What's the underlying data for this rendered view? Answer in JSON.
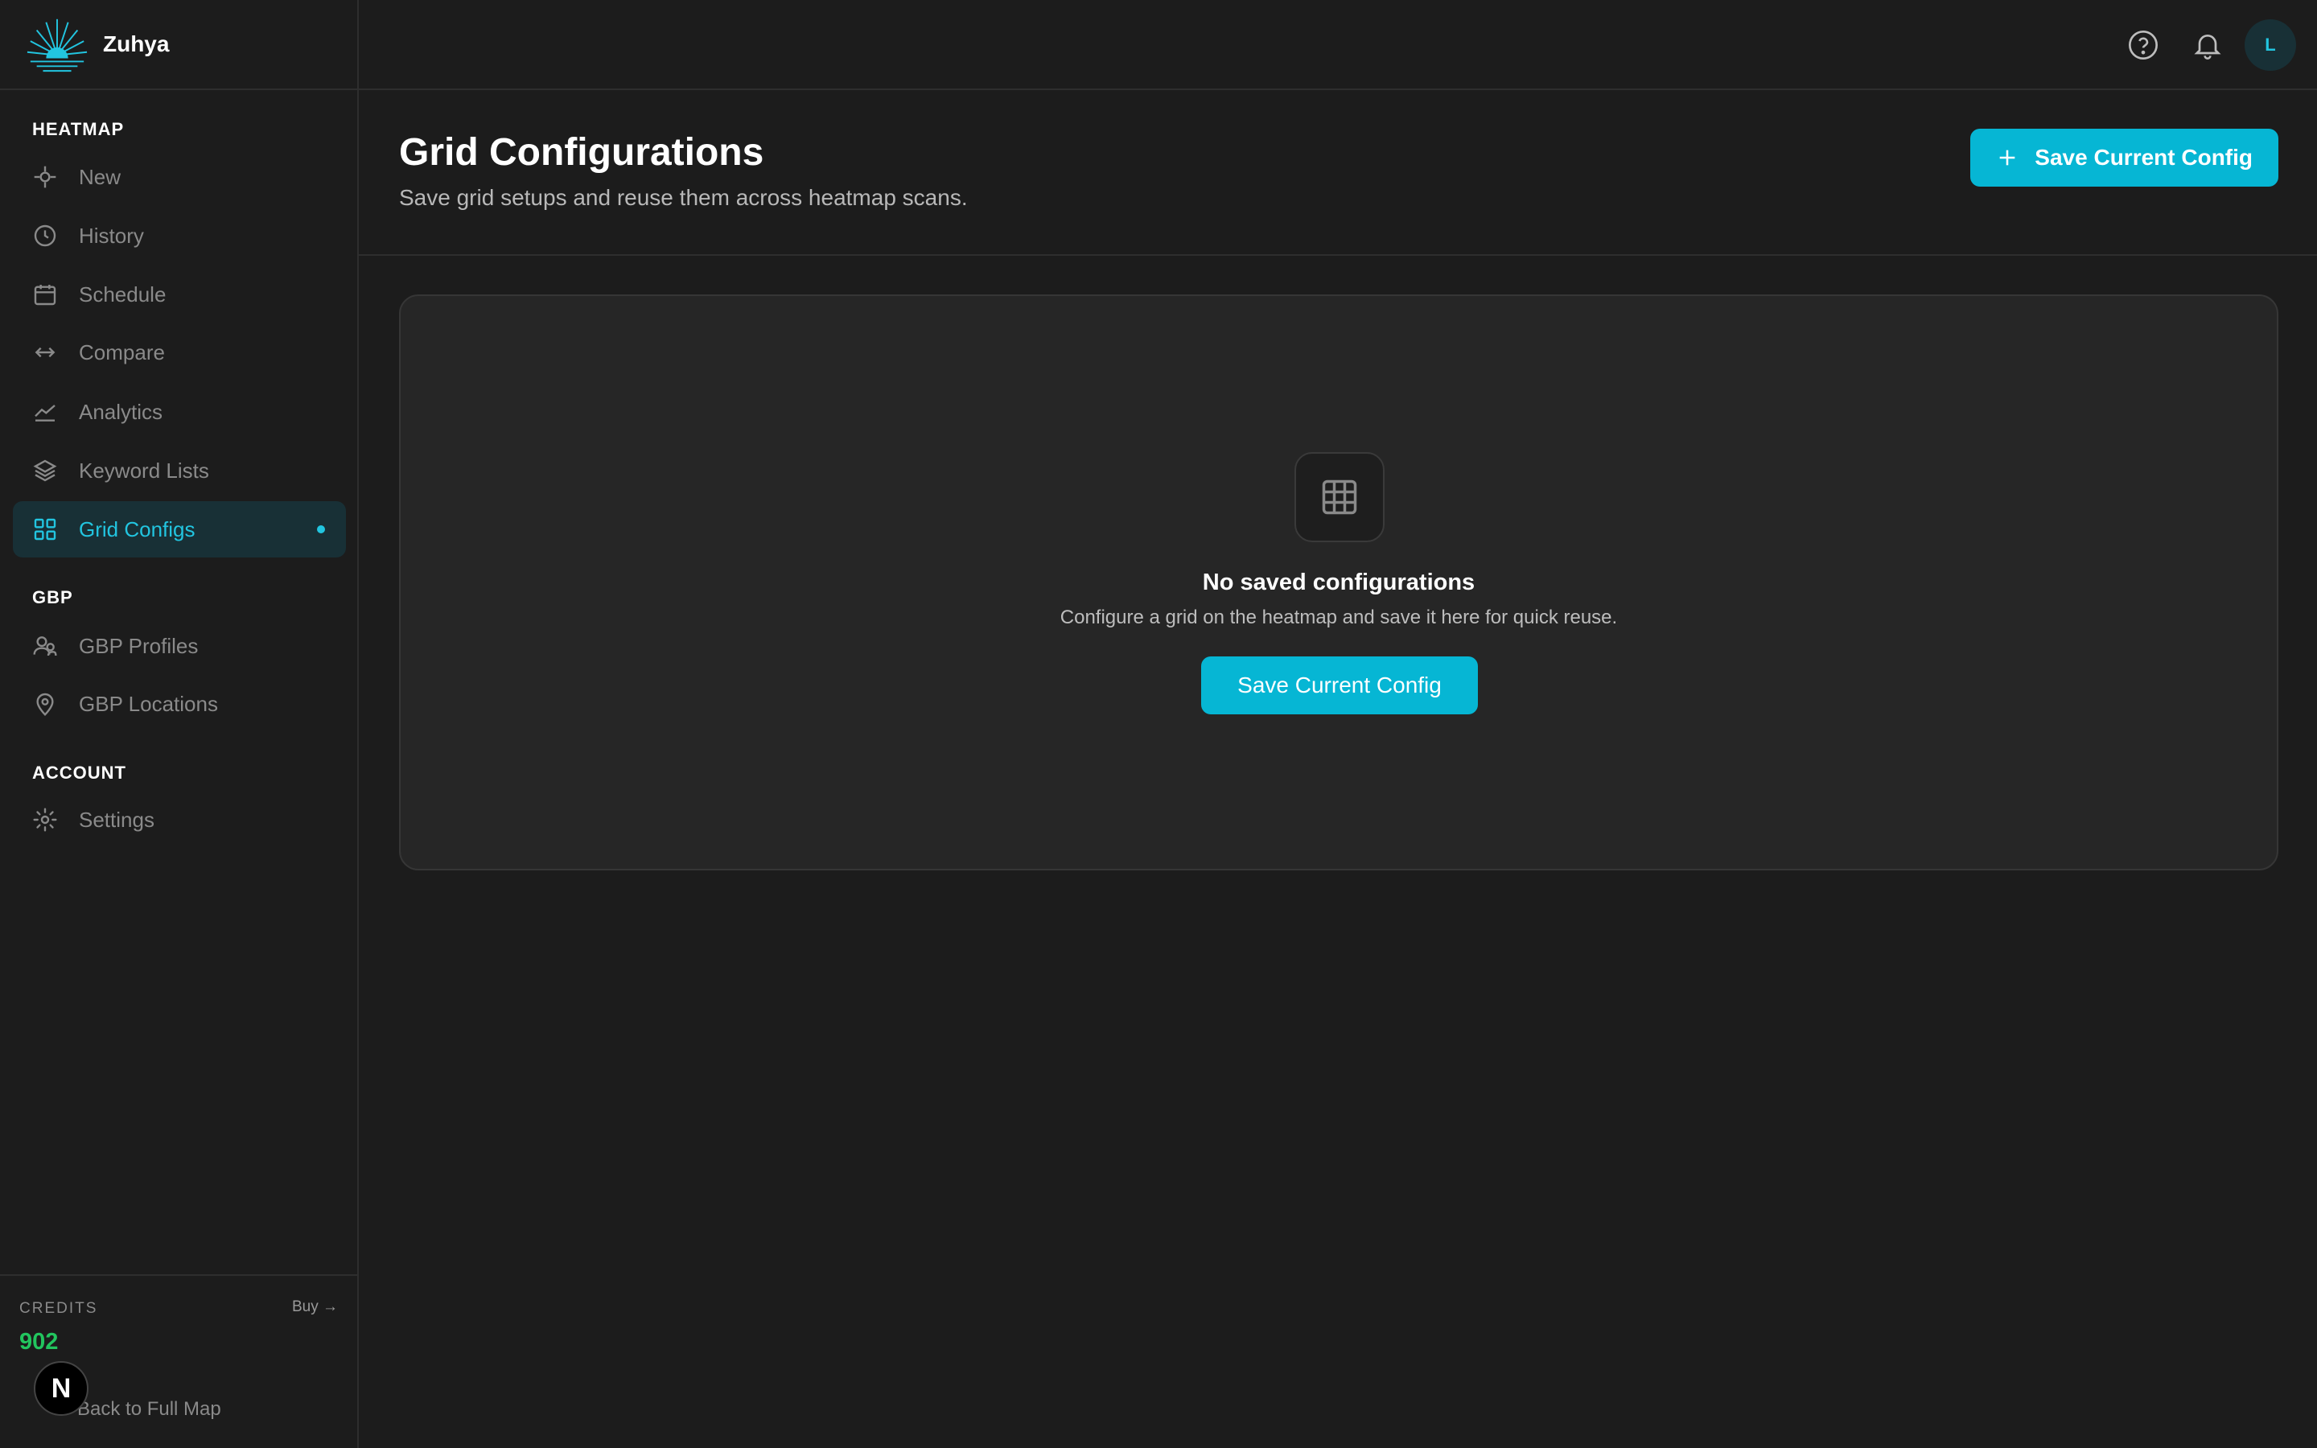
{
  "app": {
    "name": "Zuhya"
  },
  "sidebar": {
    "sections": [
      {
        "title": "HEATMAP"
      },
      {
        "title": "GBP"
      },
      {
        "title": "ACCOUNT"
      }
    ],
    "items": [
      {
        "label": "New",
        "icon": "crosshair-icon"
      },
      {
        "label": "History",
        "icon": "clock-icon"
      },
      {
        "label": "Schedule",
        "icon": "calendar-icon"
      },
      {
        "label": "Compare",
        "icon": "arrows-horizontal-icon"
      },
      {
        "label": "Analytics",
        "icon": "line-chart-icon"
      },
      {
        "label": "Keyword Lists",
        "icon": "layers-icon"
      },
      {
        "label": "Grid Configs",
        "icon": "grid-icon",
        "active": true
      },
      {
        "label": "GBP Profiles",
        "icon": "users-icon"
      },
      {
        "label": "GBP Locations",
        "icon": "map-pin-icon"
      },
      {
        "label": "Settings",
        "icon": "gear-icon"
      }
    ]
  },
  "credits": {
    "label": "CREDITS",
    "buy_label": "Buy →",
    "value": "902",
    "back_label": "Back to Full Map",
    "badge": "N"
  },
  "topbar": {
    "avatar_initial": "L",
    "icons": [
      "help-icon",
      "bell-icon"
    ]
  },
  "header": {
    "title": "Grid Configurations",
    "subtitle": "Save grid setups and reuse them across heatmap scans.",
    "button_label": "Save Current Config"
  },
  "empty_state": {
    "title": "No saved configurations",
    "text": "Configure a grid on the heatmap and save it here for quick reuse.",
    "button_label": "Save Current Config"
  },
  "colors": {
    "accent": "#06b6d4",
    "credits": "#22c55e",
    "background": "#1c1c1c"
  }
}
